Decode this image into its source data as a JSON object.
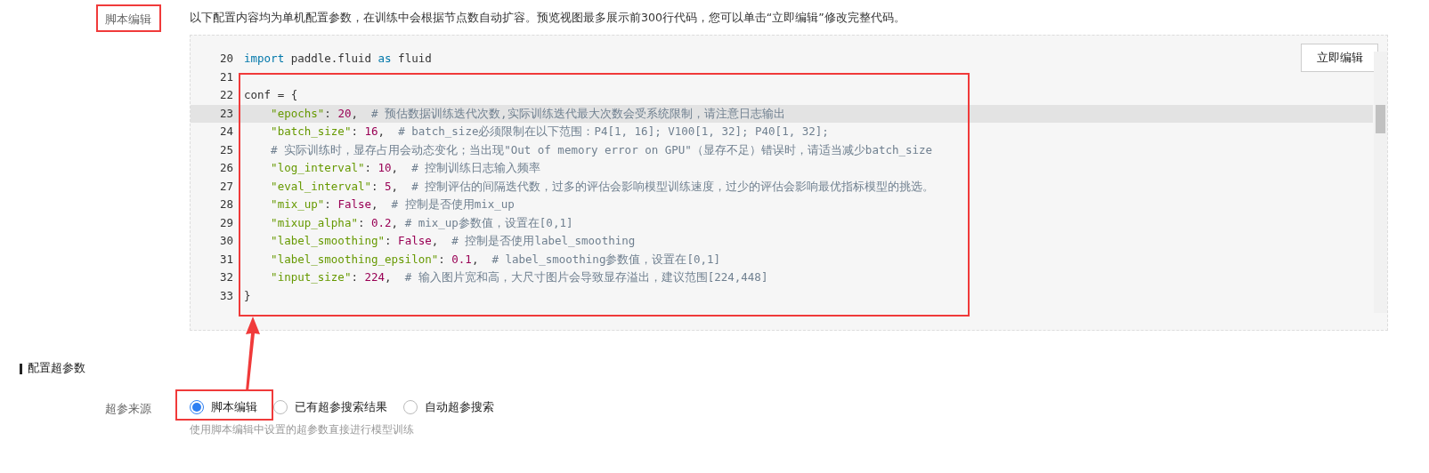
{
  "script_section": {
    "label": "脚本编辑",
    "description": "以下配置内容均为单机配置参数，在训练中会根据节点数自动扩容。预览视图最多展示前300行代码，您可以单击“立即编辑”修改完整代码。",
    "edit_button": "立即编辑",
    "code_lines": [
      {
        "number": "20",
        "tokens": [
          {
            "kind": "keyword",
            "text": "import"
          },
          {
            "kind": "plain",
            "text": " paddle.fluid "
          },
          {
            "kind": "keyword",
            "text": "as"
          },
          {
            "kind": "plain",
            "text": " fluid"
          }
        ]
      },
      {
        "number": "21"
      },
      {
        "number": "22",
        "tokens": [
          {
            "kind": "plain",
            "text": "conf = {"
          }
        ]
      },
      {
        "number": "23",
        "highlighted": true,
        "tokens": [
          {
            "kind": "string",
            "text": "    \"epochs\""
          },
          {
            "kind": "plain",
            "text": ": "
          },
          {
            "kind": "number",
            "text": "20"
          },
          {
            "kind": "plain",
            "text": ",  "
          },
          {
            "kind": "comment",
            "text": "# 预估数据训练迭代次数,实际训练迭代最大次数会受系统限制，请注意日志输出"
          }
        ]
      },
      {
        "number": "24",
        "tokens": [
          {
            "kind": "string",
            "text": "    \"batch_size\""
          },
          {
            "kind": "plain",
            "text": ": "
          },
          {
            "kind": "number",
            "text": "16"
          },
          {
            "kind": "plain",
            "text": ",  "
          },
          {
            "kind": "comment",
            "text": "# batch_size必须限制在以下范围：P4[1, 16]; V100[1, 32]; P40[1, 32];"
          }
        ]
      },
      {
        "number": "25",
        "tokens": [
          {
            "kind": "comment",
            "text": "    # 实际训练时，显存占用会动态变化；当出现\"Out of memory error on GPU\"（显存不足）错误时，请适当减少batch_size"
          }
        ]
      },
      {
        "number": "26",
        "tokens": [
          {
            "kind": "string",
            "text": "    \"log_interval\""
          },
          {
            "kind": "plain",
            "text": ": "
          },
          {
            "kind": "number",
            "text": "10"
          },
          {
            "kind": "plain",
            "text": ",  "
          },
          {
            "kind": "comment",
            "text": "# 控制训练日志输入频率"
          }
        ]
      },
      {
        "number": "27",
        "tokens": [
          {
            "kind": "string",
            "text": "    \"eval_interval\""
          },
          {
            "kind": "plain",
            "text": ": "
          },
          {
            "kind": "number",
            "text": "5"
          },
          {
            "kind": "plain",
            "text": ",  "
          },
          {
            "kind": "comment",
            "text": "# 控制评估的间隔迭代数，过多的评估会影响模型训练速度，过少的评估会影响最优指标模型的挑选。"
          }
        ]
      },
      {
        "number": "28",
        "tokens": [
          {
            "kind": "string",
            "text": "    \"mix_up\""
          },
          {
            "kind": "plain",
            "text": ": "
          },
          {
            "kind": "number",
            "text": "False"
          },
          {
            "kind": "plain",
            "text": ",  "
          },
          {
            "kind": "comment",
            "text": "# 控制是否使用mix_up"
          }
        ]
      },
      {
        "number": "29",
        "tokens": [
          {
            "kind": "string",
            "text": "    \"mixup_alpha\""
          },
          {
            "kind": "plain",
            "text": ": "
          },
          {
            "kind": "number",
            "text": "0.2"
          },
          {
            "kind": "plain",
            "text": ", "
          },
          {
            "kind": "comment",
            "text": "# mix_up参数值，设置在[0,1]"
          }
        ]
      },
      {
        "number": "30",
        "tokens": [
          {
            "kind": "string",
            "text": "    \"label_smoothing\""
          },
          {
            "kind": "plain",
            "text": ": "
          },
          {
            "kind": "number",
            "text": "False"
          },
          {
            "kind": "plain",
            "text": ",  "
          },
          {
            "kind": "comment",
            "text": "# 控制是否使用label_smoothing"
          }
        ]
      },
      {
        "number": "31",
        "tokens": [
          {
            "kind": "string",
            "text": "    \"label_smoothing_epsilon\""
          },
          {
            "kind": "plain",
            "text": ": "
          },
          {
            "kind": "number",
            "text": "0.1"
          },
          {
            "kind": "plain",
            "text": ",  "
          },
          {
            "kind": "comment",
            "text": "# label_smoothing参数值，设置在[0,1]"
          }
        ]
      },
      {
        "number": "32",
        "tokens": [
          {
            "kind": "string",
            "text": "    \"input_size\""
          },
          {
            "kind": "plain",
            "text": ": "
          },
          {
            "kind": "number",
            "text": "224"
          },
          {
            "kind": "plain",
            "text": ",  "
          },
          {
            "kind": "comment",
            "text": "# 输入图片宽和高，大尺寸图片会导致显存溢出，建议范围[224,448]"
          }
        ]
      },
      {
        "number": "33",
        "tokens": [
          {
            "kind": "plain",
            "text": "}"
          }
        ]
      }
    ]
  },
  "hyperparam_section": {
    "title": "配置超参数",
    "source_label": "超参来源",
    "options": [
      {
        "label": "脚本编辑",
        "selected": true
      },
      {
        "label": "已有超参搜索结果",
        "selected": false
      },
      {
        "label": "自动超参搜索",
        "selected": false
      }
    ],
    "hint": "使用脚本编辑中设置的超参数直接进行模型训练"
  }
}
